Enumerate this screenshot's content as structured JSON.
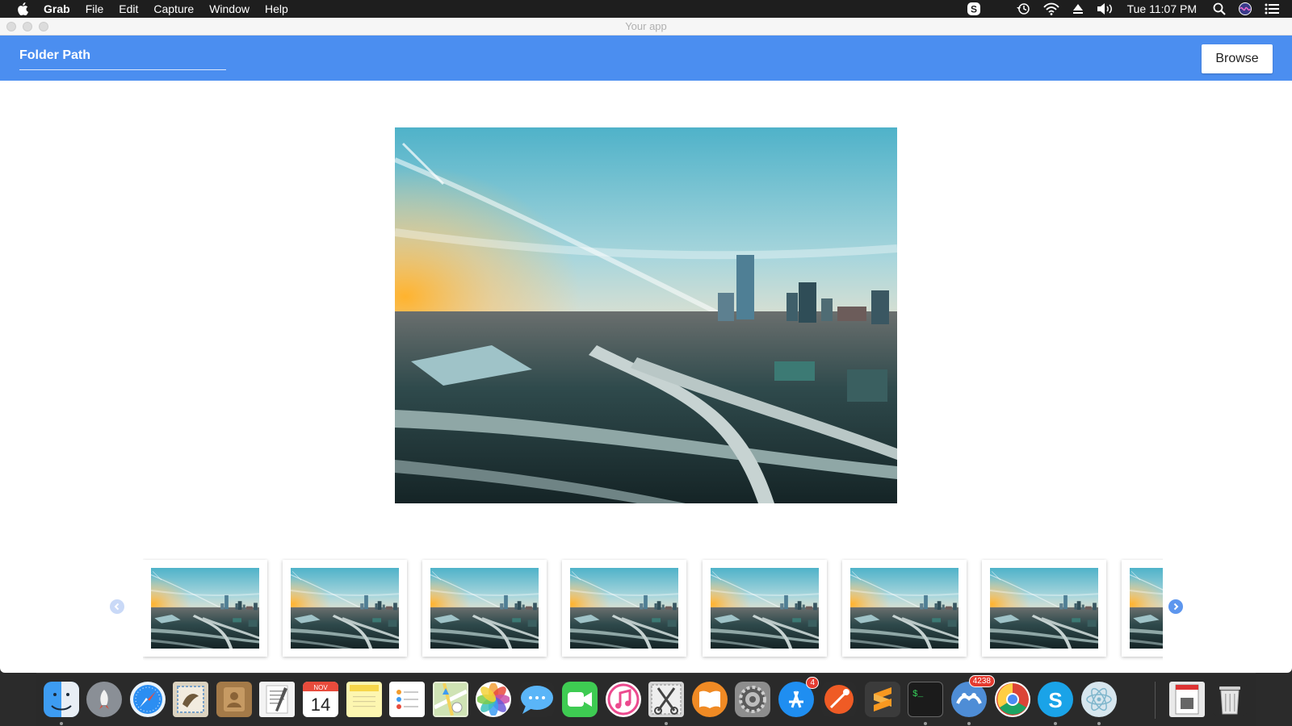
{
  "menubar": {
    "app_name": "Grab",
    "items": [
      "File",
      "Edit",
      "Capture",
      "Window",
      "Help"
    ],
    "clock": "Tue 11:07 PM"
  },
  "window": {
    "title": "Your app",
    "folder_path_label": "Folder Path",
    "browse_label": "Browse"
  },
  "thumbnails": {
    "count": 8
  },
  "dock": {
    "calendar_month": "NOV",
    "calendar_day": "14",
    "appstore_badge": "4",
    "mail_badge": "4238",
    "terminal_text": "$_"
  },
  "colors": {
    "header_blue": "#4b8ef0",
    "nav_active": "#5d96ee",
    "nav_inactive": "#c9d9f7"
  }
}
